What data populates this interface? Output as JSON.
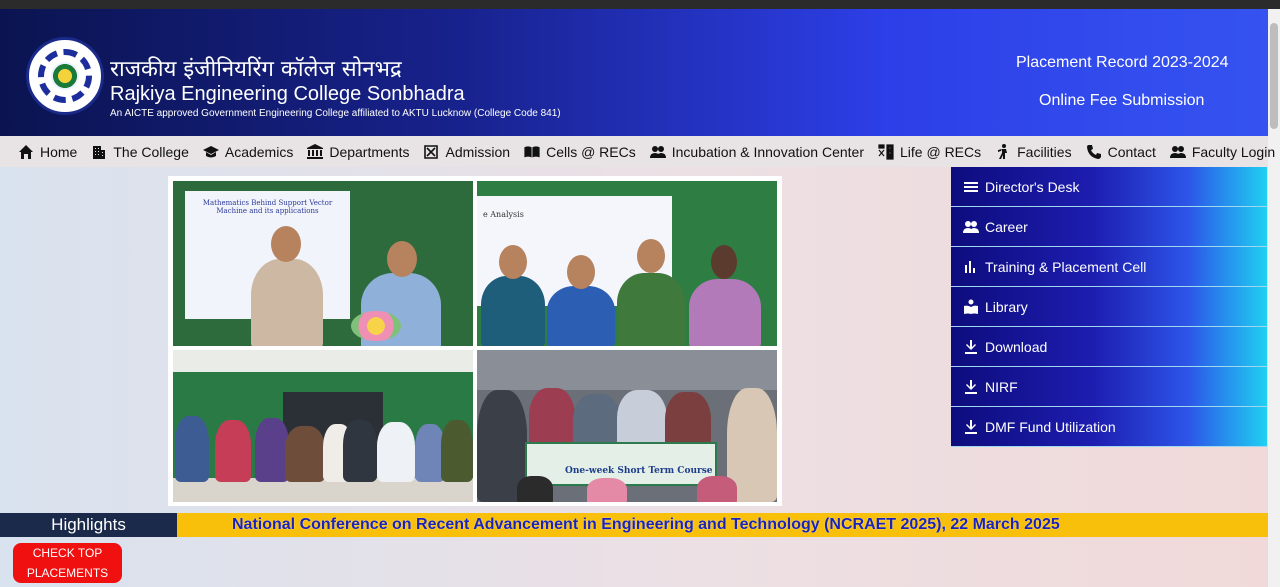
{
  "header": {
    "title_hindi": "राजकीय इंजीनियरिंग कॉलेज सोनभद्र",
    "title_english": "Rajkiya Engineering College Sonbhadra",
    "subtitle": "An AICTE approved Government Engineering College affiliated to AKTU Lucknow (College Code 841)",
    "links": [
      "Placement Record 2023-2024",
      "Online Fee Submission"
    ],
    "colors": {
      "gradient_start": "#0b1450",
      "gradient_end": "#3553f0"
    }
  },
  "nav": {
    "items": [
      {
        "label": "Home",
        "icon": "home-icon"
      },
      {
        "label": "The College",
        "icon": "building-icon"
      },
      {
        "label": "Academics",
        "icon": "graduation-cap-icon"
      },
      {
        "label": "Departments",
        "icon": "institution-icon"
      },
      {
        "label": "Admission",
        "icon": "admission-icon"
      },
      {
        "label": "Cells @ RECs",
        "icon": "book-open-icon"
      },
      {
        "label": "Incubation & Innovation Center",
        "icon": "users-icon"
      },
      {
        "label": "Life @ RECs",
        "icon": "sports-icon"
      },
      {
        "label": "Facilities",
        "icon": "person-walking-icon"
      },
      {
        "label": "Contact",
        "icon": "phone-icon"
      },
      {
        "label": "Faculty Login",
        "icon": "users-icon"
      }
    ]
  },
  "gallery": {
    "photo1_slide_title": "Mathematics Behind Support Vector Machine and its applications",
    "photo2_slide_title": "e Analysis",
    "photo4_banner": "One-week Short Term Course"
  },
  "sidebar": {
    "items": [
      {
        "label": "Director's Desk",
        "icon": "list-icon"
      },
      {
        "label": "Career",
        "icon": "users-icon"
      },
      {
        "label": "Training & Placement Cell",
        "icon": "bar-chart-icon"
      },
      {
        "label": "Library",
        "icon": "reader-icon"
      },
      {
        "label": "Download",
        "icon": "download-icon"
      },
      {
        "label": "NIRF",
        "icon": "download-icon"
      },
      {
        "label": "DMF Fund Utilization",
        "icon": "download-icon"
      }
    ]
  },
  "highlights": {
    "label": "Highlights",
    "text": "National Conference on Recent Advancement in Engineering and Technology (NCRAET 2025), 22 March 2025"
  },
  "check_button": {
    "line1": "CHECK TOP",
    "line2": "PLACEMENTS"
  }
}
